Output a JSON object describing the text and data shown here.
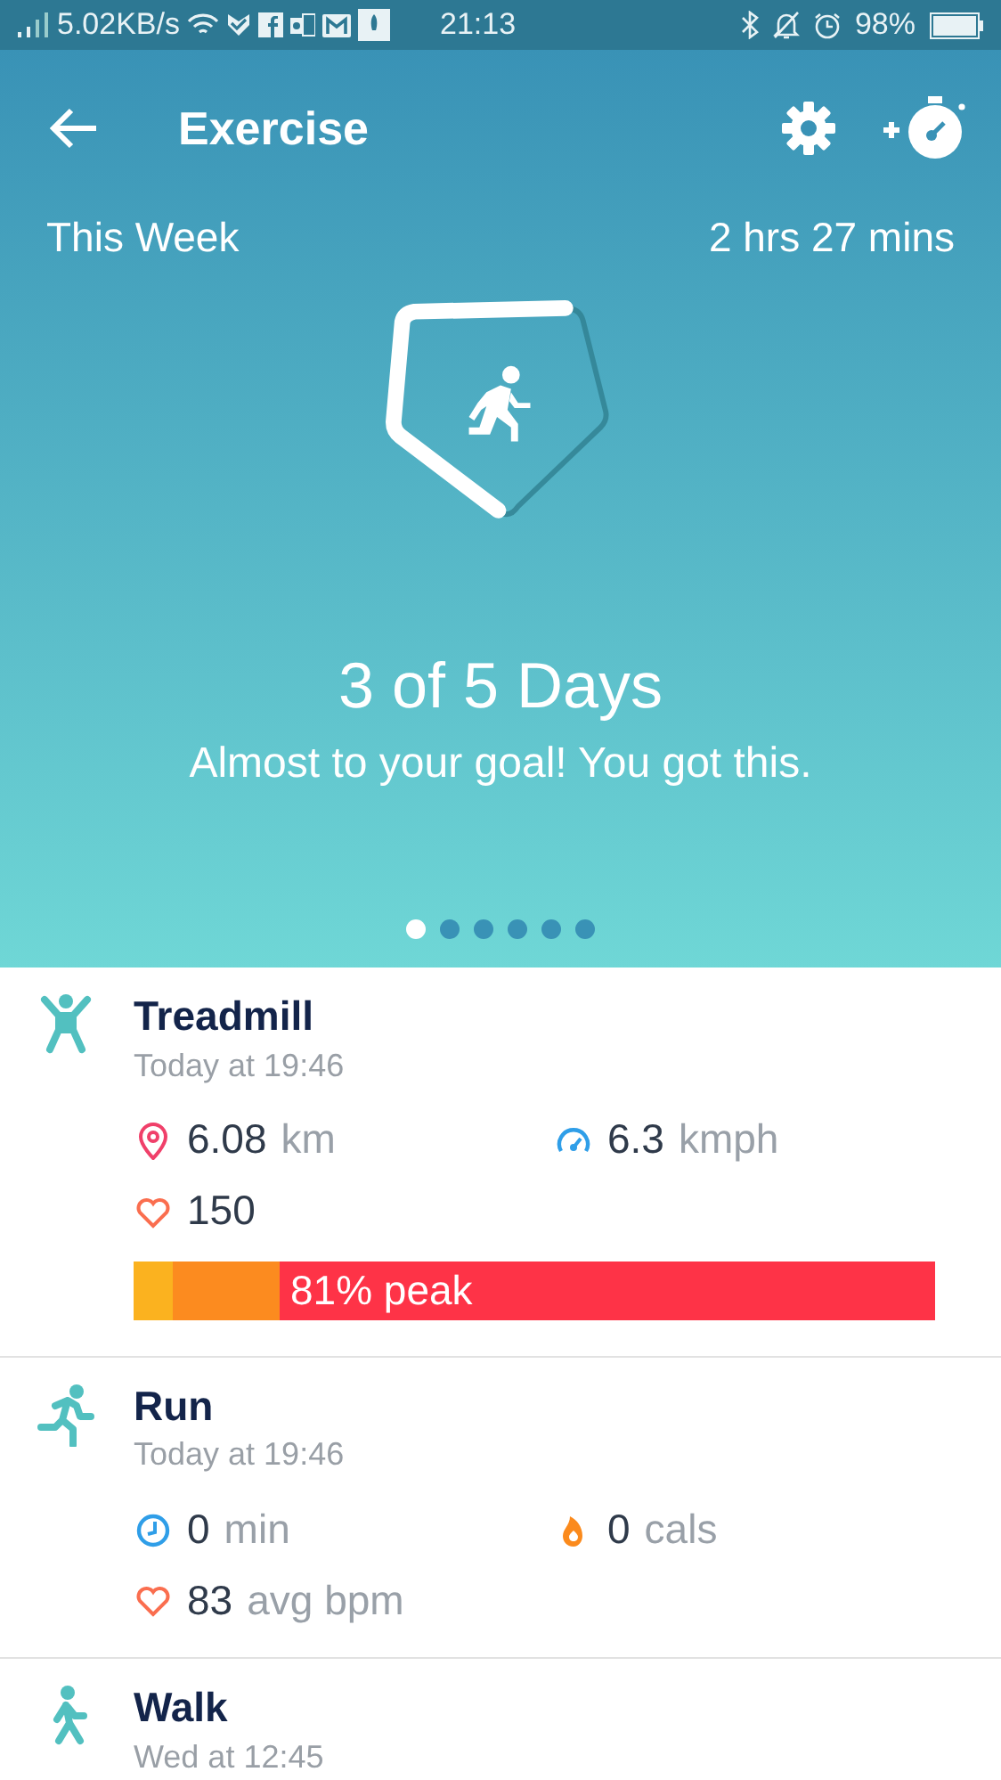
{
  "status_bar": {
    "speed": "5.02KB/s",
    "time": "21:13",
    "battery": "98%"
  },
  "header": {
    "title": "Exercise"
  },
  "summary": {
    "label": "This Week",
    "total": "2 hrs 27 mins",
    "headline": "3 of 5 Days",
    "message": "Almost to your goal! You got this."
  },
  "pager": [
    {
      "selected": true
    },
    {
      "selected": false
    },
    {
      "selected": false
    },
    {
      "selected": false
    },
    {
      "selected": false
    },
    {
      "selected": false
    }
  ],
  "activities": [
    {
      "kind": "treadmill",
      "name": "Treadmill",
      "time": "Today at 19:46",
      "stats": [
        {
          "kind": "distance",
          "value": "6.08",
          "unit": "km"
        },
        {
          "kind": "speed",
          "value": "6.3",
          "unit": "kmph"
        },
        {
          "kind": "heart",
          "value": "150"
        }
      ],
      "zones": [
        {
          "color": "#fbb21f"
        },
        {
          "color": "#fc8b1f"
        },
        {
          "color": "#fe3347",
          "label": "81% peak"
        }
      ]
    },
    {
      "kind": "run",
      "name": "Run",
      "time": "Today at 19:46",
      "stats": [
        {
          "kind": "duration",
          "value": "0",
          "unit": "min"
        },
        {
          "kind": "calories",
          "value": "0",
          "unit": "cals"
        },
        {
          "kind": "heart",
          "value": "83",
          "unit": "avg bpm"
        }
      ]
    },
    {
      "kind": "walk",
      "name": "Walk",
      "time": "Wed at 12:45"
    }
  ]
}
